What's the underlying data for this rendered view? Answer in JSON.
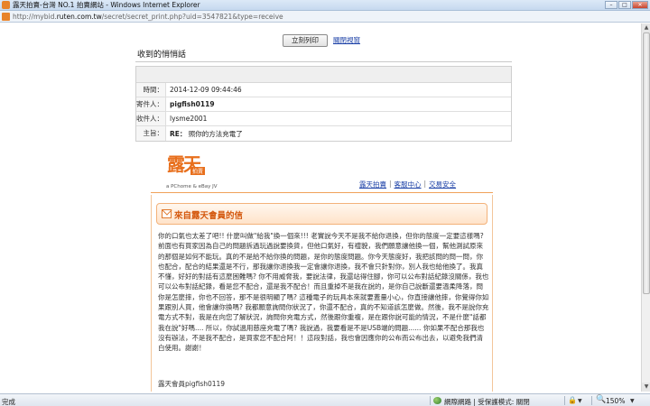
{
  "window": {
    "title": "露天拍賣-台灣 NO.1 拍賣網站 - Windows Internet Explorer",
    "minimize": "–",
    "maximize": "□",
    "close": "✕"
  },
  "address": {
    "prefix": "http://mybid.",
    "host": "ruten.com.tw",
    "path": "/secret/secret_print.php?uid=3547821&type=receive"
  },
  "toolbar": {
    "print_label": "立刻列印",
    "preview_label": "關閉視窗"
  },
  "message": {
    "heading": "收到的悄悄話",
    "rows": [
      {
        "label": "時間：",
        "value": "2014-12-09 09:44:46",
        "bold": false
      },
      {
        "label": "寄件人：",
        "value": "pigfish0119",
        "bold": true
      },
      {
        "label": "收件人：",
        "value": "lysme2001",
        "bold": false
      },
      {
        "label": "主旨：",
        "value_bold": "RE：",
        "value": "照你的方法充電了"
      }
    ]
  },
  "logo": {
    "chars": "露天",
    "badge": "拍賣",
    "sub": "a PChome & eBay JV"
  },
  "nav": {
    "items": [
      "露天拍賣",
      "客服中心",
      "交易安全"
    ],
    "separator": "|"
  },
  "letter": {
    "heading": "來自露天會員的信",
    "body": "你的口氣也太差了吧!! 什麼叫做\"給我\"換一個來!!! 老實說今天不是我不給你退換，但你的態度一定要這樣嗎? 前面也有買家因為自己的問題拆過玩過說要換貨，但他口氣好，有禮貌，我們願意讓他換一個，幫他測試原來的那個是如何不能玩。真的不是給不給你換的問題，是你的態度問題。你今天態度好，我把該問的問一問，你也配合，配合的結果還是不行，那我讓你退換我一定會讓你退換，我不會只針對你，別人我也給他換了。我真不懂，好好的對話有這麼困難嗎? 你不用威脅我，要說法律，我還站得住腳，你可以公布對話紀錄沒關係，我也可以公布對話紀錄，看是您不配合，還是我不配合！而且重掉不是我在說的，是你自己說斷還要溫柔降落，問你是怎麼摔，你也不回答，那不是很明顯了嗎? 這種電子的玩具本來就要蓋量小心，你直接讓他摔，你覺得你如果跟別人買，他會讓你換嗎? 我都願意詢問你狀況了，你還不配合，真的不知道該怎麼做。然後，我不是說你充電方式不對，我是在向您了解狀況，詢問你充電方式，然後跟你重複，是在跟你說可能的情況，不是什麼\"話都我在說\"好嗎.... 所以，你試過用慈座充電了嗎? 我說過，我要看是不是USB端的問題...... 你如果不配合那我也沒有辦法，不是我不配合，是買家您不配合阿！！這段對話，我也會因應你的公布而公布出去，以避免我們清白使用。謝謝！",
    "signature": "露天會員pigfish0119"
  },
  "status": {
    "left": "完成",
    "zone": "網際網路 | 受保護模式: 關閉",
    "zoom": "150%",
    "zoom_icon": "🔍",
    "lock_icon": "🔒",
    "arrow": "▼"
  },
  "scrollbar": {
    "up": "▲",
    "down": "▼"
  }
}
